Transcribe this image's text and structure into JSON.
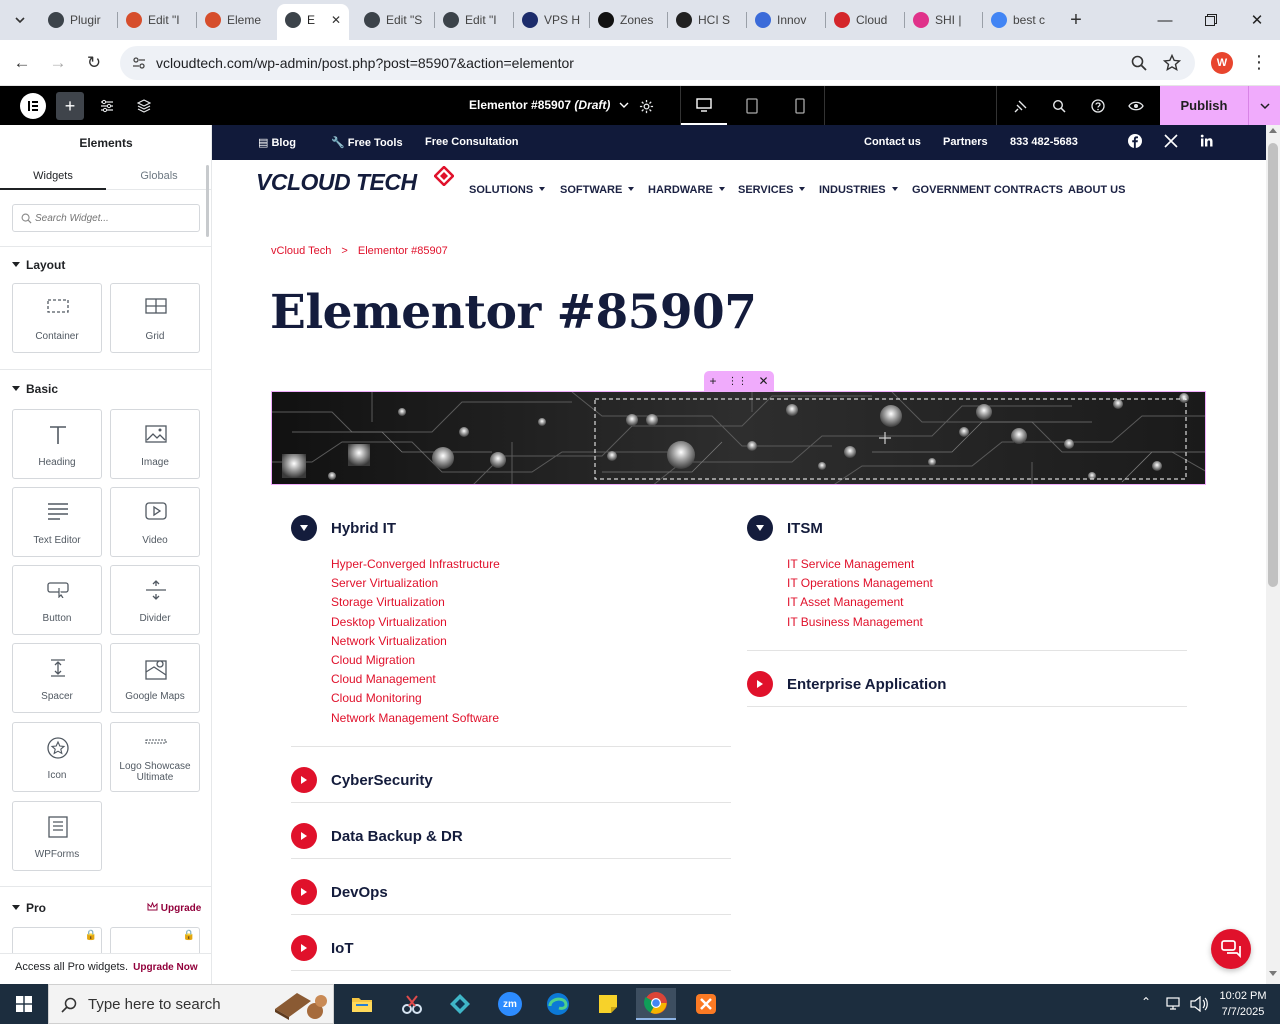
{
  "browser": {
    "tabs": [
      {
        "title": "Plugir",
        "icon": "wordpress-icon",
        "color": "#3c434a"
      },
      {
        "title": "Edit \"I",
        "icon": "elementor-orange-icon",
        "color": "#d64e2c"
      },
      {
        "title": "Eleme",
        "icon": "elementor-orange-icon",
        "color": "#d64e2c"
      },
      {
        "title": "E",
        "icon": "wordpress-icon",
        "color": "#3c434a",
        "active": true
      },
      {
        "title": "Edit \"S",
        "icon": "wordpress-icon",
        "color": "#3c434a"
      },
      {
        "title": "Edit \"I",
        "icon": "wordpress-icon",
        "color": "#3c434a"
      },
      {
        "title": "VPS H",
        "icon": "v-logo-icon",
        "color": "#1c2c6b"
      },
      {
        "title": "Zones",
        "icon": "z-logo-icon",
        "color": "#111111"
      },
      {
        "title": "HCI S",
        "icon": "openai-icon",
        "color": "#222222"
      },
      {
        "title": "Innov",
        "icon": "wave-logo-icon",
        "color": "#3b6bd9"
      },
      {
        "title": "Cloud",
        "icon": "swoosh-logo-icon",
        "color": "#d4262b"
      },
      {
        "title": "SHI |",
        "icon": "circle-logo-icon",
        "color": "#e0328a"
      },
      {
        "title": "best c",
        "icon": "google-icon",
        "color": "#4285f4"
      }
    ],
    "url": "vcloudtech.com/wp-admin/post.php?post=85907&action=elementor",
    "profile_initial": "W"
  },
  "editor": {
    "document_title": "Elementor #85907",
    "document_status": "(Draft)",
    "publish_label": "Publish"
  },
  "panel": {
    "title": "Elements",
    "tabs": [
      "Widgets",
      "Globals"
    ],
    "search_placeholder": "Search Widget...",
    "layout_title": "Layout",
    "layout_widgets": [
      "Container",
      "Grid"
    ],
    "basic_title": "Basic",
    "basic_widgets": [
      "Heading",
      "Image",
      "Text Editor",
      "Video",
      "Button",
      "Divider",
      "Spacer",
      "Google Maps",
      "Icon",
      "Logo Showcase Ultimate",
      "WPForms"
    ],
    "pro_title": "Pro",
    "upgrade_label": "Upgrade",
    "access_text": "Access all Pro widgets.",
    "upgrade_now": "Upgrade Now"
  },
  "site": {
    "topbar": {
      "left_links": [
        "Blog",
        "Free Tools",
        "Free Consultation"
      ],
      "right_links": [
        "Contact us",
        "Partners",
        "833 482-5683"
      ]
    },
    "logo_text": "VCLOUD TECH",
    "menu": [
      {
        "label": "SOLUTIONS",
        "dropdown": true
      },
      {
        "label": "SOFTWARE",
        "dropdown": true
      },
      {
        "label": "HARDWARE",
        "dropdown": true
      },
      {
        "label": "SERVICES",
        "dropdown": true
      },
      {
        "label": "INDUSTRIES",
        "dropdown": true
      },
      {
        "label": "GOVERNMENT CONTRACTS",
        "dropdown": false
      },
      {
        "label": "ABOUT US",
        "dropdown": false
      }
    ],
    "breadcrumb": {
      "home": "vCloud Tech",
      "sep": ">",
      "current": "Elementor #85907"
    },
    "page_title": "Elementor #85907",
    "accordion_left": [
      {
        "title": "Hybrid IT",
        "open": true,
        "items": [
          "Hyper-Converged Infrastructure",
          "Server Virtualization",
          "Storage Virtualization",
          "Desktop Virtualization",
          "Network Virtualization",
          "Cloud Migration",
          "Cloud Management",
          "Cloud Monitoring",
          "Network Management Software"
        ]
      },
      {
        "title": "CyberSecurity",
        "open": false
      },
      {
        "title": "Data Backup & DR",
        "open": false
      },
      {
        "title": "DevOps",
        "open": false
      },
      {
        "title": "IoT",
        "open": false
      }
    ],
    "accordion_right": [
      {
        "title": "ITSM",
        "open": true,
        "items": [
          "IT Service Management",
          "IT Operations Management",
          "IT Asset Management",
          "IT Business Management"
        ]
      },
      {
        "title": "Enterprise Application",
        "open": false
      }
    ]
  },
  "taskbar": {
    "search_placeholder": "Type here to search",
    "time": "10:02 PM",
    "date": "7/7/2025"
  },
  "colors": {
    "brand_navy": "#111a3a",
    "brand_red": "#e0112b",
    "publish_pink": "#f0abfc"
  }
}
